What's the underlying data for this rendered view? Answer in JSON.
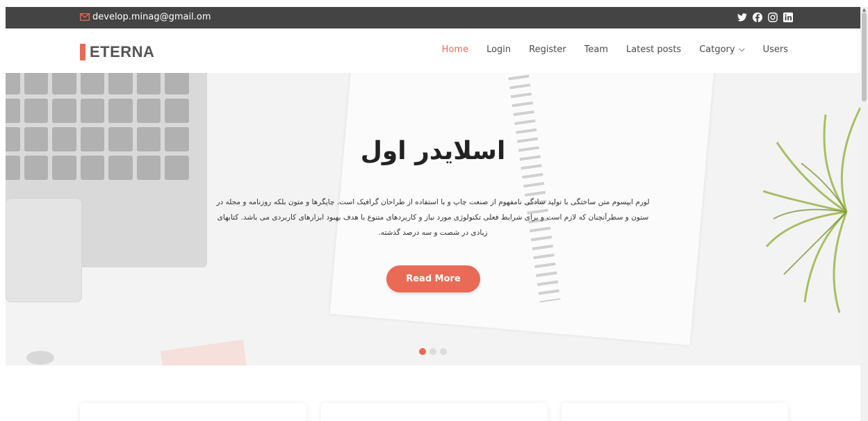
{
  "topbar": {
    "email": "develop.minag@gmail.om",
    "socials": [
      "twitter-icon",
      "facebook-icon",
      "instagram-icon",
      "linkedin-icon"
    ]
  },
  "brand": {
    "name": "ETERNA"
  },
  "nav": {
    "items": [
      {
        "label": "Home",
        "active": true
      },
      {
        "label": "Login",
        "active": false
      },
      {
        "label": "Register",
        "active": false
      },
      {
        "label": "Team",
        "active": false
      },
      {
        "label": "Latest posts",
        "active": false
      },
      {
        "label": "Catgory",
        "active": false
      },
      {
        "label": "Users",
        "active": false
      }
    ]
  },
  "hero": {
    "title": "اسلایدر اول",
    "text": "لورم ایپسوم متن ساختگی با تولید سادگی نامفهوم از صنعت چاپ و با استفاده از طراحان گرافیک است. چاپگرها و متون بلکه روزنامه و مجله در ستون و سطرآنچنان که لازم است و برای شرایط فعلی تکنولوژی مورد نیاز و کاربردهای متنوع با هدف بهبود ابزارهای کاربردی می باشد. کتابهای زیادی در شصت و سه درصد گذشته.",
    "cta": "Read More",
    "slides": 3,
    "active_slide": 1
  },
  "colors": {
    "accent": "#e96b56",
    "topbar": "#444444"
  }
}
